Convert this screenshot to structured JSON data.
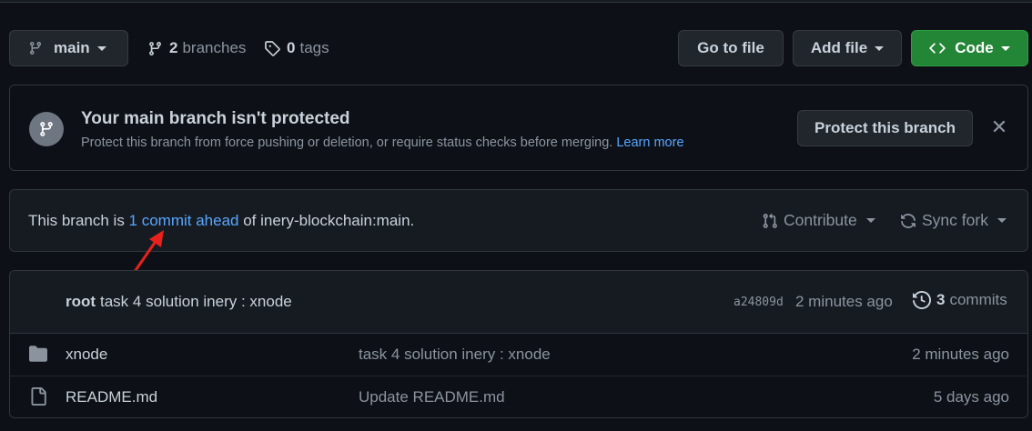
{
  "toolbar": {
    "branch_label": "main",
    "branches_count": "2",
    "branches_label": "branches",
    "tags_count": "0",
    "tags_label": "tags",
    "goto_file_label": "Go to file",
    "add_file_label": "Add file",
    "code_label": "Code"
  },
  "banner": {
    "title": "Your main branch isn't protected",
    "description": "Protect this branch from force pushing or deletion, or require status checks before merging.",
    "learn_more": "Learn more",
    "protect_button": "Protect this branch",
    "close_glyph": "✕"
  },
  "ahead": {
    "prefix": "This branch is ",
    "link": "1 commit ahead",
    "suffix": " of inery-blockchain:main.",
    "contribute_label": "Contribute",
    "sync_label": "Sync fork"
  },
  "latest_commit": {
    "author": "root",
    "message": "task 4 solution inery : xnode",
    "sha": "a24809d",
    "time": "2 minutes ago",
    "count": "3",
    "count_label": "commits"
  },
  "files": [
    {
      "type": "folder",
      "name": "xnode",
      "commit": "task 4 solution inery : xnode",
      "time": "2 minutes ago"
    },
    {
      "type": "file",
      "name": "README.md",
      "commit": "Update README.md",
      "time": "5 days ago"
    }
  ],
  "colors": {
    "background": "#0d1117",
    "accent_green": "#238636",
    "link_blue": "#58a6ff",
    "annotation_red": "#e8211c"
  }
}
